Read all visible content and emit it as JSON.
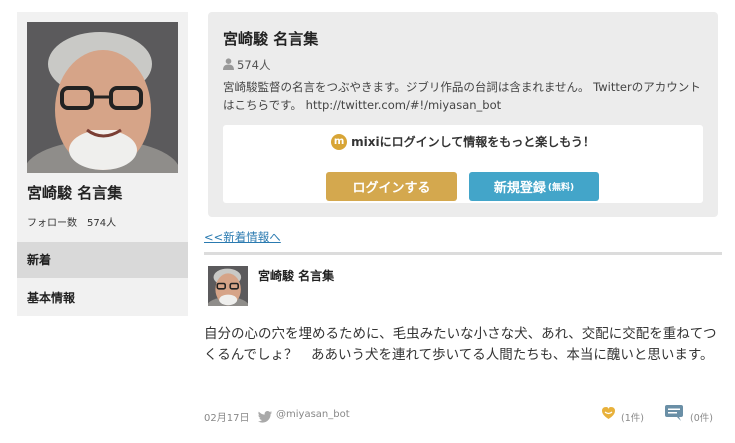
{
  "profile": {
    "name": "宮崎駿 名言集",
    "follow_label": "フォロー数",
    "follow_count": "574人"
  },
  "nav": {
    "items": [
      {
        "label": "新着",
        "active": true
      },
      {
        "label": "基本情報",
        "active": false
      }
    ]
  },
  "card": {
    "title": "宮崎駿 名言集",
    "member_count": "574人",
    "description": "宮崎駿監督の名言をつぶやきます。ジブリ作品の台詞は含まれません。 Twitterのアカウントはこちらです。 http://twitter.com/#!/miyasan_bot",
    "login_promo": "mixiにログインして情報をもっと楽しもう！",
    "mixi_logo_glyph": "m",
    "login_button": "ログインする",
    "register_button": "新規登録",
    "register_sub": "(無料)"
  },
  "back_link": "<<新着情報へ",
  "post": {
    "author": "宮崎駿 名言集",
    "body": "自分の心の穴を埋めるために、毛虫みたいな小さな犬、あれ、交配に交配を重ねてつくるんでしょ？　ああいう犬を連れて歩いてる人間たちも、本当に醜いと思います。",
    "date": "02月17日",
    "handle": "@miyasan_bot",
    "like_count": "(1件)",
    "comment_count": "(0件)"
  },
  "colors": {
    "login": "#d4a84e",
    "register": "#43a5c9",
    "link": "#2a7ab0",
    "card_bg": "#ececec",
    "sidebar_bg": "#f1f1f1"
  },
  "icons": [
    "person-icon",
    "mixi-logo-icon",
    "twitter-bird-icon",
    "like-icon",
    "comment-icon"
  ]
}
